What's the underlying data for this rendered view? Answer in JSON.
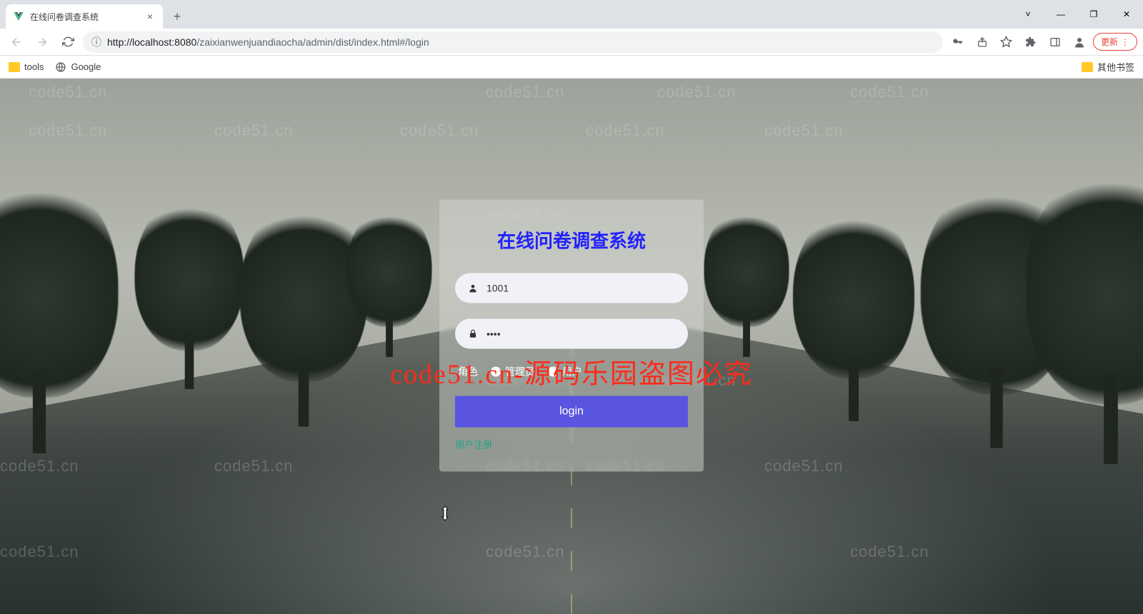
{
  "browser": {
    "tab_title": "在线问卷调查系统",
    "url_info_icon": "ⓘ",
    "url_prefix": "http://",
    "url_host": "localhost",
    "url_port": ":8080",
    "url_path": "/zaixianwenjuandiaocha/admin/dist/index.html#/login",
    "update_label": "更新",
    "bookmarks": {
      "tools": "tools",
      "google": "Google",
      "other": "其他书签"
    }
  },
  "watermarks": {
    "text": "code51.cn",
    "big": "code51.cn-源码乐园盗图必究"
  },
  "login": {
    "title": "在线问卷调查系统",
    "username_value": "1001",
    "password_value": "••••",
    "role_label": "角色",
    "role_admin": "管理员",
    "role_user": "用户",
    "login_button": "login",
    "register_link": "用户注册"
  }
}
